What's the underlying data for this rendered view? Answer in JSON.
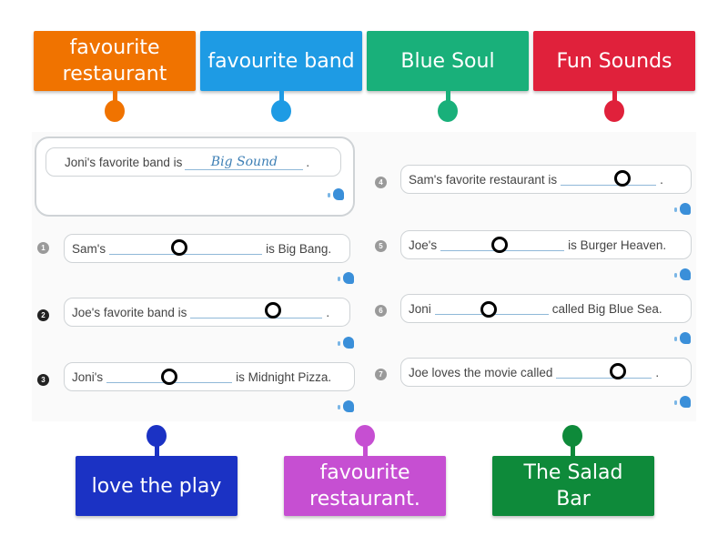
{
  "labels_top": [
    {
      "text": "favourite restaurant",
      "color": "#f07300"
    },
    {
      "text": "favourite band",
      "color": "#1e9be4"
    },
    {
      "text": "Blue Soul",
      "color": "#19b07a"
    },
    {
      "text": "Fun Sounds",
      "color": "#e0213b"
    }
  ],
  "labels_bottom": [
    {
      "text": "love the play",
      "color": "#1b32c4"
    },
    {
      "text": "favourite restaurant.",
      "color": "#c64fd2"
    },
    {
      "text": "The Salad Bar",
      "color": "#0e8a3a"
    }
  ],
  "worksheet": {
    "example": {
      "before": "Joni's favorite band is",
      "answer": "Big Sound",
      "after": "."
    },
    "items": [
      {
        "number": "1",
        "before": "Sam's",
        "after": "is Big Bang."
      },
      {
        "number": "2",
        "before": "Joe's favorite band is",
        "after": "."
      },
      {
        "number": "3",
        "before": "Joni's",
        "after": "is Midnight Pizza."
      },
      {
        "number": "4",
        "before": "Sam's favorite restaurant is",
        "after": "."
      },
      {
        "number": "5",
        "before": "Joe's",
        "after": "is Burger Heaven."
      },
      {
        "number": "6",
        "before": "Joni",
        "after": "called Big Blue Sea."
      },
      {
        "number": "7",
        "before": "Joe loves the movie called",
        "after": "."
      }
    ]
  }
}
